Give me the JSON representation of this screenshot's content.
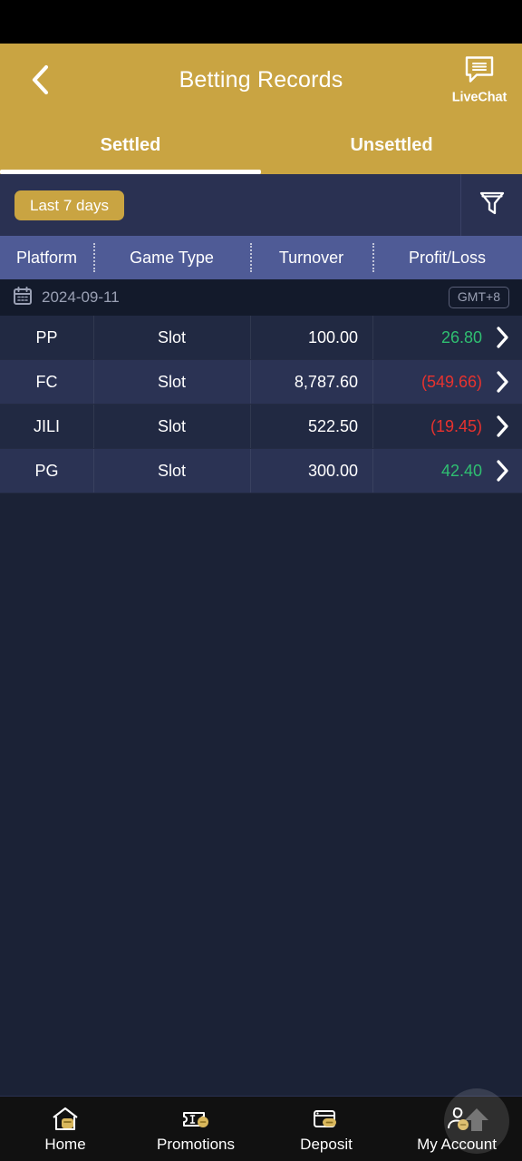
{
  "statusbar": {},
  "header": {
    "title": "Betting Records",
    "back_icon": "chevron-left-icon",
    "livechat": {
      "label": "LiveChat",
      "icon": "chat-bubble-icon"
    },
    "tabs": [
      {
        "label": "Settled",
        "active": true
      },
      {
        "label": "Unsettled",
        "active": false
      }
    ]
  },
  "filterbar": {
    "chip_label": "Last 7 days",
    "filter_icon": "funnel-icon"
  },
  "table": {
    "columns": [
      "Platform",
      "Game Type",
      "Turnover",
      "Profit/Loss"
    ],
    "date_group": {
      "calendar_icon": "calendar-icon",
      "date": "2024-09-11",
      "timezone": "GMT+8"
    },
    "rows": [
      {
        "platform": "PP",
        "game_type": "Slot",
        "turnover": "100.00",
        "profit_loss": "26.80",
        "sign": "pos"
      },
      {
        "platform": "FC",
        "game_type": "Slot",
        "turnover": "8,787.60",
        "profit_loss": "(549.66)",
        "sign": "neg"
      },
      {
        "platform": "JILI",
        "game_type": "Slot",
        "turnover": "522.50",
        "profit_loss": "(19.45)",
        "sign": "neg"
      },
      {
        "platform": "PG",
        "game_type": "Slot",
        "turnover": "300.00",
        "profit_loss": "42.40",
        "sign": "pos"
      }
    ],
    "row_chevron_icon": "chevron-right-icon"
  },
  "bottom_nav": {
    "items": [
      {
        "label": "Home",
        "icon": "home-icon"
      },
      {
        "label": "Promotions",
        "icon": "ticket-coin-icon"
      },
      {
        "label": "Deposit",
        "icon": "wallet-coin-icon"
      },
      {
        "label": "My Account",
        "icon": "user-coin-icon"
      }
    ],
    "scroll_top": {
      "icon": "arrow-up-icon"
    }
  },
  "colors": {
    "gold": "#C9A442",
    "header_blue": "#4F5B96",
    "bg_navy": "#1B2236",
    "row_odd": "#212942",
    "row_even": "#2B3354",
    "positive": "#2FBF71",
    "negative": "#E8322E"
  }
}
